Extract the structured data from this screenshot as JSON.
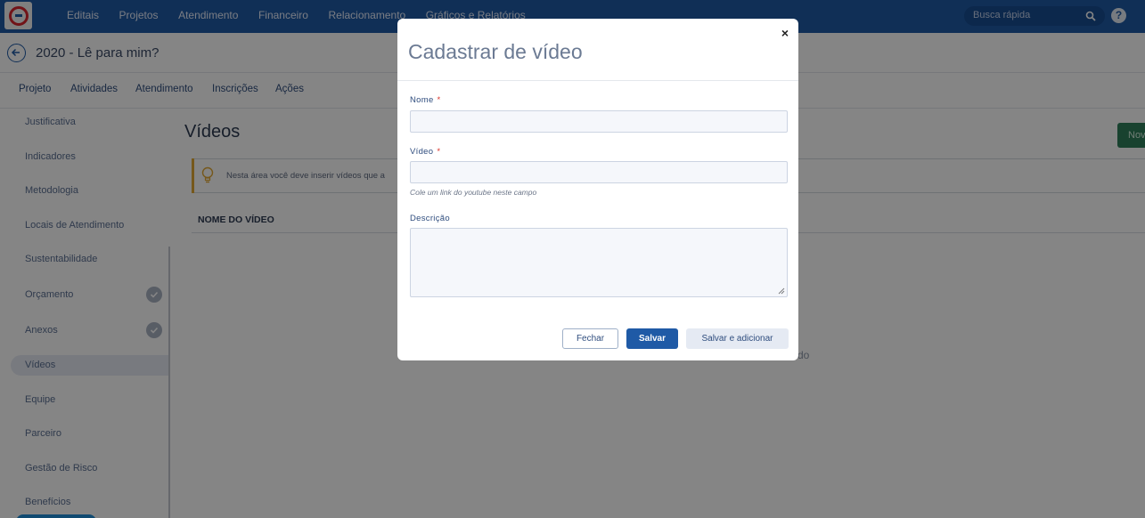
{
  "topbar": {
    "nav": [
      "Editais",
      "Projetos",
      "Atendimento",
      "Financeiro",
      "Relacionamento",
      "Gráficos e Relatórios"
    ],
    "search_placeholder": "Busca rápida",
    "help": "?"
  },
  "header": {
    "title": "2020 - Lê para mim?"
  },
  "tabs": [
    "Projeto",
    "Atividades",
    "Atendimento",
    "Inscrições",
    "Ações"
  ],
  "sidebar": {
    "items": [
      "Justificativa",
      "Indicadores",
      "Metodologia",
      "Locais de Atendimento",
      "Sustentabilidade",
      "Orçamento",
      "Anexos",
      "Vídeos",
      "Equipe",
      "Parceiro",
      "Gestão de Risco",
      "Benefícios"
    ],
    "active": "Vídeos",
    "completed": [
      "Orçamento",
      "Anexos"
    ]
  },
  "main": {
    "title": "Vídeos",
    "new_button": "Nov",
    "info_text": "Nesta área você deve inserir vídeos que a",
    "column_header": "NOME DO VÍDEO",
    "empty_text_fragment": "do"
  },
  "modal": {
    "title": "Cadastrar de vídeo",
    "close": "×",
    "fields": {
      "name_label": "Nome",
      "video_label": "Vídeo",
      "video_hint": "Cole um link do youtube neste campo",
      "description_label": "Descrição",
      "required_mark": "*"
    },
    "buttons": {
      "close": "Fechar",
      "save": "Salvar",
      "save_add": "Salvar e adicionar"
    }
  }
}
